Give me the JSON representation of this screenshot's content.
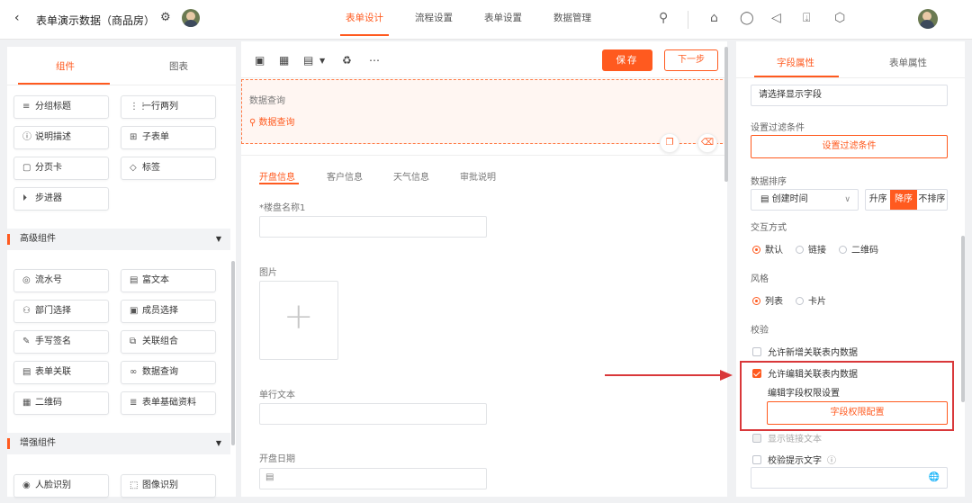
{
  "header": {
    "back_icon": "chevron-left-icon",
    "title": "表单演示数据（商品房）",
    "tabs": [
      {
        "label": "表单设计",
        "active": true
      },
      {
        "label": "流程设置",
        "active": false
      },
      {
        "label": "表单设置",
        "active": false
      },
      {
        "label": "数据管理",
        "active": false
      }
    ],
    "right_icons": [
      "search-icon",
      "home-icon",
      "shirt-icon",
      "megaphone-icon",
      "download-icon",
      "hexagon-settings-icon"
    ]
  },
  "left_panel": {
    "tabs": [
      {
        "label": "组件",
        "active": true
      },
      {
        "label": "图表",
        "active": false
      }
    ],
    "basic_components": [
      {
        "icon": "≡",
        "label": "分组标题"
      },
      {
        "icon": "⋮⋮",
        "label": "一行两列"
      },
      {
        "icon": "ⓘ",
        "label": "说明描述"
      },
      {
        "icon": "⊞",
        "label": "子表单"
      },
      {
        "icon": "▢",
        "label": "分页卡"
      },
      {
        "icon": "◇",
        "label": "标签"
      },
      {
        "icon": "⏵",
        "label": "步进器"
      }
    ],
    "advanced_section": "高级组件",
    "advanced_components": [
      {
        "icon": "◎",
        "label": "流水号"
      },
      {
        "icon": "▤",
        "label": "富文本"
      },
      {
        "icon": "⚇",
        "label": "部门选择"
      },
      {
        "icon": "▣",
        "label": "成员选择"
      },
      {
        "icon": "✎",
        "label": "手写签名"
      },
      {
        "icon": "⧉",
        "label": "关联组合"
      },
      {
        "icon": "▤",
        "label": "表单关联"
      },
      {
        "icon": "∞",
        "label": "数据查询"
      },
      {
        "icon": "▦",
        "label": "二维码"
      },
      {
        "icon": "≣",
        "label": "表单基础资料"
      }
    ],
    "enhanced_section": "增强组件",
    "enhanced_components": [
      {
        "icon": "◉",
        "label": "人脸识别"
      },
      {
        "icon": "⬚",
        "label": "图像识别"
      }
    ]
  },
  "center_panel": {
    "toolbar_icons": [
      "preview-icon",
      "layout-icon",
      "list-icon",
      "clear-icon",
      "more-icon"
    ],
    "save_label": "保存",
    "next_label": "下一步",
    "selected_field": {
      "label": "数据查询",
      "value": "数据查询"
    },
    "form_tabs": [
      {
        "label": "开盘信息",
        "active": true
      },
      {
        "label": "客户信息",
        "active": false
      },
      {
        "label": "天气信息",
        "active": false
      },
      {
        "label": "审批说明",
        "active": false
      }
    ],
    "fields": {
      "building_name": "*楼盘名称1",
      "image": "图片",
      "single_text": "单行文本",
      "open_date": "开盘日期"
    }
  },
  "right_panel": {
    "tabs": [
      {
        "label": "字段属性",
        "active": true
      },
      {
        "label": "表单属性",
        "active": false
      }
    ],
    "display_field_placeholder": "请选择显示字段",
    "filter_label": "设置过滤条件",
    "filter_button": "设置过滤条件",
    "sort_label": "数据排序",
    "sort_field": "创建时间",
    "sort_options": [
      {
        "label": "升序",
        "active": false
      },
      {
        "label": "降序",
        "active": true
      },
      {
        "label": "不排序",
        "active": false
      }
    ],
    "interaction_label": "交互方式",
    "interaction_options": [
      {
        "label": "默认",
        "checked": true
      },
      {
        "label": "链接",
        "checked": false
      },
      {
        "label": "二维码",
        "checked": false
      }
    ],
    "style_label": "风格",
    "style_options": [
      {
        "label": "列表",
        "checked": true
      },
      {
        "label": "卡片",
        "checked": false
      }
    ],
    "validation_label": "校验",
    "allow_add": {
      "label": "允许新增关联表内数据",
      "checked": false
    },
    "allow_edit": {
      "label": "允许编辑关联表内数据",
      "checked": true
    },
    "edit_permission_label": "编辑字段权限设置",
    "edit_permission_button": "字段权限配置",
    "show_link": {
      "label": "显示链接文本",
      "checked": false
    },
    "hint_text": {
      "label": "校验提示文字",
      "checked": false
    }
  },
  "colors": {
    "accent": "#ff5a1f",
    "highlight_frame": "#d9383a"
  }
}
